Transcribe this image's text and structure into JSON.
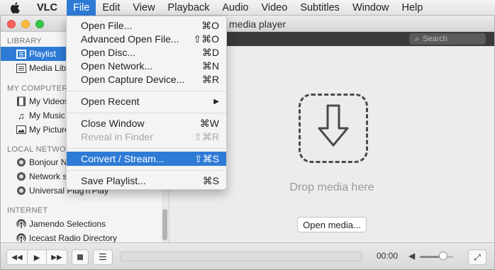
{
  "menubar": {
    "app_name": "VLC",
    "items": [
      "File",
      "Edit",
      "View",
      "Playback",
      "Audio",
      "Video",
      "Subtitles",
      "Window",
      "Help"
    ]
  },
  "window": {
    "title": "media player"
  },
  "sidebar": {
    "sections": {
      "library": "LIBRARY",
      "my_computer": "MY COMPUTER",
      "local_network": "LOCAL NETWORK",
      "internet": "INTERNET"
    },
    "items": [
      {
        "label": "Playlist",
        "icon": "playlist-icon"
      },
      {
        "label": "Media Library",
        "icon": "media-library-icon"
      },
      {
        "label": "My Videos",
        "icon": "film-icon"
      },
      {
        "label": "My Music",
        "icon": "music-note-icon"
      },
      {
        "label": "My Pictures",
        "icon": "pictures-icon"
      },
      {
        "label": "Bonjour Network Discovery",
        "icon": "network-icon"
      },
      {
        "label": "Network streams (SAP)",
        "icon": "network-icon"
      },
      {
        "label": "Universal Plug'n'Play",
        "icon": "network-icon"
      },
      {
        "label": "Jamendo Selections",
        "icon": "podcast-icon"
      },
      {
        "label": "Icecast Radio Directory",
        "icon": "podcast-icon"
      }
    ]
  },
  "main": {
    "search_placeholder": "Search",
    "drop_text": "Drop media here",
    "open_media_label": "Open media..."
  },
  "controls": {
    "time": "00:00",
    "volume_fraction": 0.78
  },
  "file_menu": {
    "items": [
      {
        "label": "Open File...",
        "shortcut": "⌘O",
        "enabled": true
      },
      {
        "label": "Advanced Open File...",
        "shortcut": "⇧⌘O",
        "enabled": true
      },
      {
        "label": "Open Disc...",
        "shortcut": "⌘D",
        "enabled": true
      },
      {
        "label": "Open Network...",
        "shortcut": "⌘N",
        "enabled": true
      },
      {
        "label": "Open Capture Device...",
        "shortcut": "⌘R",
        "enabled": true
      },
      {
        "label": "Open Recent",
        "shortcut": "▶",
        "enabled": true
      },
      {
        "label": "Close Window",
        "shortcut": "⌘W",
        "enabled": true
      },
      {
        "label": "Reveal in Finder",
        "shortcut": "⇧⌘R",
        "enabled": false
      },
      {
        "label": "Convert / Stream...",
        "shortcut": "⇧⌘S",
        "enabled": true,
        "highlighted": true
      },
      {
        "label": "Save Playlist...",
        "shortcut": "⌘S",
        "enabled": true
      }
    ]
  },
  "colors": {
    "accent": "#2e7bd6",
    "toolstrip": "#3a3a3a"
  }
}
